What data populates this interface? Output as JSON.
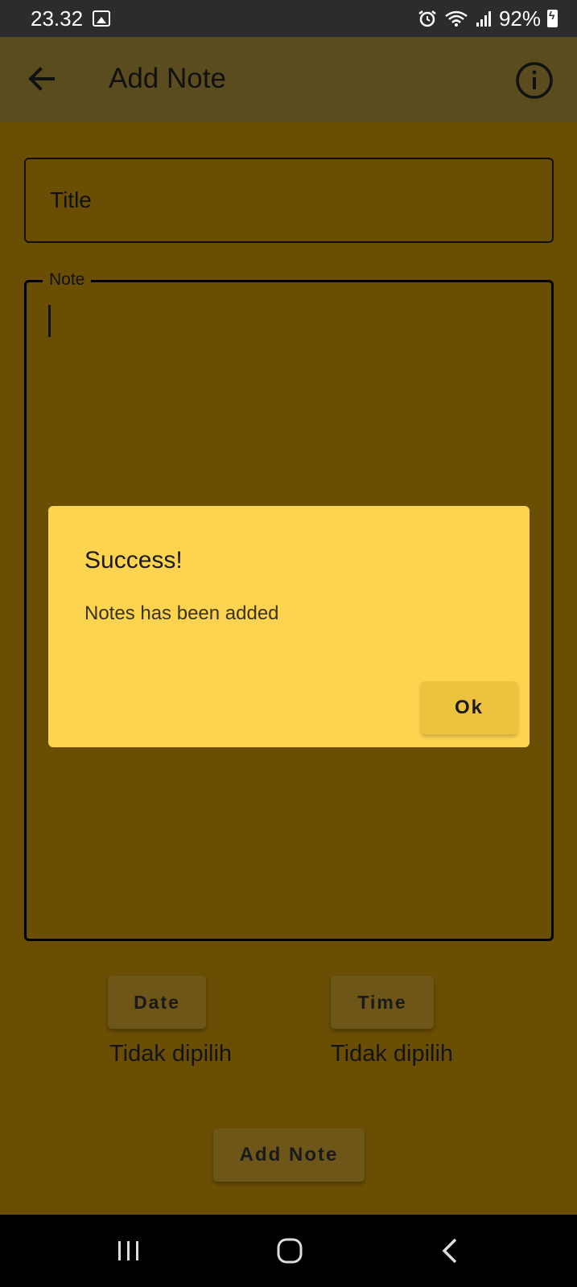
{
  "status_bar": {
    "time": "23.32",
    "battery": "92%",
    "icons": [
      "gallery-icon",
      "alarm-icon",
      "wifi-icon",
      "signal-icon",
      "battery-charging-icon"
    ]
  },
  "app_bar": {
    "title": "Add Note",
    "back_icon": "arrow-left-icon",
    "info_icon": "info-icon"
  },
  "form": {
    "title_placeholder": "Title",
    "title_value": "",
    "note_label": "Note",
    "note_value": "",
    "date_button": "Date",
    "time_button": "Time",
    "date_value": "Tidak dipilih",
    "time_value": "Tidak dipilih",
    "submit_button": "Add Note"
  },
  "dialog": {
    "title": "Success!",
    "message": "Notes has been added",
    "ok_button": "Ok"
  },
  "nav_bar": {
    "icons": [
      "recent-apps-icon",
      "home-icon",
      "back-icon"
    ]
  },
  "colors": {
    "background": "#6a4e04",
    "app_bar": "#5b4c20",
    "dialog": "#fdd44f",
    "button": "#6d5617",
    "dialog_button": "#edc23f"
  }
}
